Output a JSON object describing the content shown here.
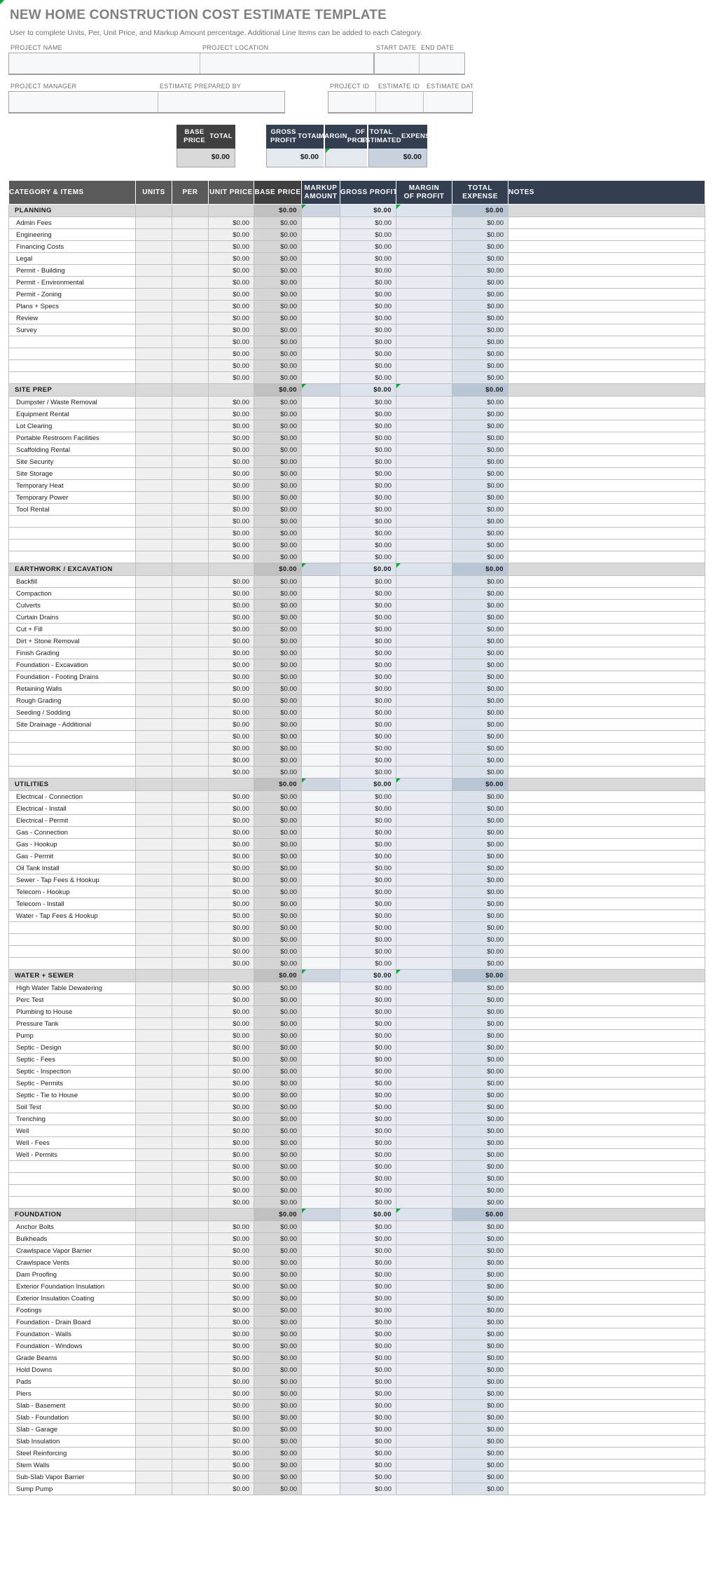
{
  "header": {
    "title": "NEW HOME CONSTRUCTION COST ESTIMATE TEMPLATE",
    "subtitle": "User to complete Units, Per, Unit Price, and Markup Amount percentage.  Additional Line Items can be added to each Category."
  },
  "form": {
    "row1": [
      {
        "label": "PROJECT NAME",
        "value": ""
      },
      {
        "label": "PROJECT LOCATION",
        "value": ""
      },
      {
        "label": "START DATE",
        "value": ""
      },
      {
        "label": "END DATE",
        "value": ""
      }
    ],
    "row2": [
      {
        "label": "PROJECT MANAGER",
        "value": ""
      },
      {
        "label": "ESTIMATE PREPARED BY",
        "value": ""
      },
      {
        "label": "PROJECT ID",
        "value": ""
      },
      {
        "label": "ESTIMATE ID",
        "value": ""
      },
      {
        "label": "ESTIMATE DATE",
        "value": ""
      }
    ]
  },
  "summary": {
    "base": {
      "label": "BASE PRICE\nTOTAL",
      "label_l1": "BASE PRICE",
      "label_l2": "TOTAL",
      "value": "$0.00"
    },
    "gross": {
      "label_l1": "GROSS PROFIT",
      "label_l2": "TOTAL",
      "value": "$0.00"
    },
    "margin": {
      "label_l1": "MARGIN",
      "label_l2": "OF PROFIT",
      "value": ""
    },
    "expense": {
      "label_l1": "TOTAL ESTIMATED",
      "label_l2": "EXPENSE",
      "value": "$0.00"
    }
  },
  "table": {
    "columns": [
      {
        "key": "name",
        "label_l1": "CATEGORY & ITEMS",
        "label_l2": ""
      },
      {
        "key": "units",
        "label_l1": "UNITS",
        "label_l2": ""
      },
      {
        "key": "per",
        "label_l1": "PER",
        "label_l2": ""
      },
      {
        "key": "unit",
        "label_l1": "UNIT PRICE",
        "label_l2": ""
      },
      {
        "key": "base",
        "label_l1": "BASE PRICE",
        "label_l2": ""
      },
      {
        "key": "mark",
        "label_l1": "MARKUP",
        "label_l2": "AMOUNT"
      },
      {
        "key": "gross",
        "label_l1": "GROSS PROFIT",
        "label_l2": ""
      },
      {
        "key": "margin",
        "label_l1": "MARGIN",
        "label_l2": "OF PROFIT"
      },
      {
        "key": "total",
        "label_l1": "TOTAL",
        "label_l2": "EXPENSE"
      },
      {
        "key": "notes",
        "label_l1": "NOTES",
        "label_l2": ""
      }
    ],
    "zero": "$0.00",
    "sections": [
      {
        "name": "PLANNING",
        "totals": {
          "base": "$0.00",
          "gross": "$0.00",
          "total": "$0.00"
        },
        "items": [
          "Admin Fees",
          "Engineering",
          "Financing Costs",
          "Legal",
          "Permit - Building",
          "Permit - Environmental",
          "Permit - Zoning",
          "Plans + Specs",
          "Review",
          "Survey"
        ],
        "blanks": 4
      },
      {
        "name": "SITE PREP",
        "totals": {
          "base": "$0.00",
          "gross": "$0.00",
          "total": "$0.00"
        },
        "items": [
          "Dumpster / Waste Removal",
          "Equipment Rental",
          "Lot Clearing",
          "Portable Restroom Facilities",
          "Scaffolding Rental",
          "Site Security",
          "Site Storage",
          "Temporary Heat",
          "Temporary Power",
          "Tool Rental"
        ],
        "blanks": 4
      },
      {
        "name": "EARTHWORK / EXCAVATION",
        "totals": {
          "base": "$0.00",
          "gross": "$0.00",
          "total": "$0.00"
        },
        "items": [
          "Backfill",
          "Compaction",
          "Culverts",
          "Curtain Drains",
          "Cut + Fill",
          "Dirt + Stone Removal",
          "Finish Grading",
          "Foundation - Excavation",
          "Foundation - Footing Drains",
          "Retaining Walls",
          "Rough Grading",
          "Seeding / Sodding",
          "Site Drainage - Additional"
        ],
        "blanks": 4
      },
      {
        "name": "UTILITIES",
        "totals": {
          "base": "$0.00",
          "gross": "$0.00",
          "total": "$0.00"
        },
        "items": [
          "Electrical - Connection",
          "Electrical - Install",
          "Electrical - Permit",
          "Gas - Connection",
          "Gas - Hookup",
          "Gas - Permit",
          "Oil Tank Install",
          "Sewer - Tap Fees & Hookup",
          "Telecom - Hookup",
          "Telecom - Install",
          "Water - Tap Fees & Hookup"
        ],
        "blanks": 4
      },
      {
        "name": "WATER + SEWER",
        "totals": {
          "base": "$0.00",
          "gross": "$0.00",
          "total": "$0.00"
        },
        "items": [
          "High Water Table Dewatering",
          "Perc Test",
          "Plumbing to House",
          "Pressure Tank",
          "Pump",
          "Septic - Design",
          "Septic - Fees",
          "Septic - Inspection",
          "Septic - Permits",
          "Septic - Tie to House",
          "Soil Test",
          "Trenching",
          "Well",
          "Well - Fees",
          "Well - Permits"
        ],
        "blanks": 4
      },
      {
        "name": "FOUNDATION",
        "totals": {
          "base": "$0.00",
          "gross": "$0.00",
          "total": "$0.00"
        },
        "items": [
          "Anchor Bolts",
          "Bulkheads",
          "Crawlspace Vapor Barrier",
          "Crawlspace Vents",
          "Dam Proofing",
          "Exterior Foundation Insulation",
          "Exterior Insulation Coating",
          "Footings",
          "Foundation - Drain Board",
          "Foundation - Walls",
          "Foundation - Windows",
          "Grade Beams",
          "Hold Downs",
          "Pads",
          "Piers",
          "Slab - Basement",
          "Slab - Foundation",
          "Slab - Garage",
          "Slab Insulation",
          "Steel Reinforcing",
          "Stem Walls",
          "Sub-Slab Vapor Barrier",
          "Sump Pump"
        ],
        "blanks": 0
      }
    ]
  }
}
